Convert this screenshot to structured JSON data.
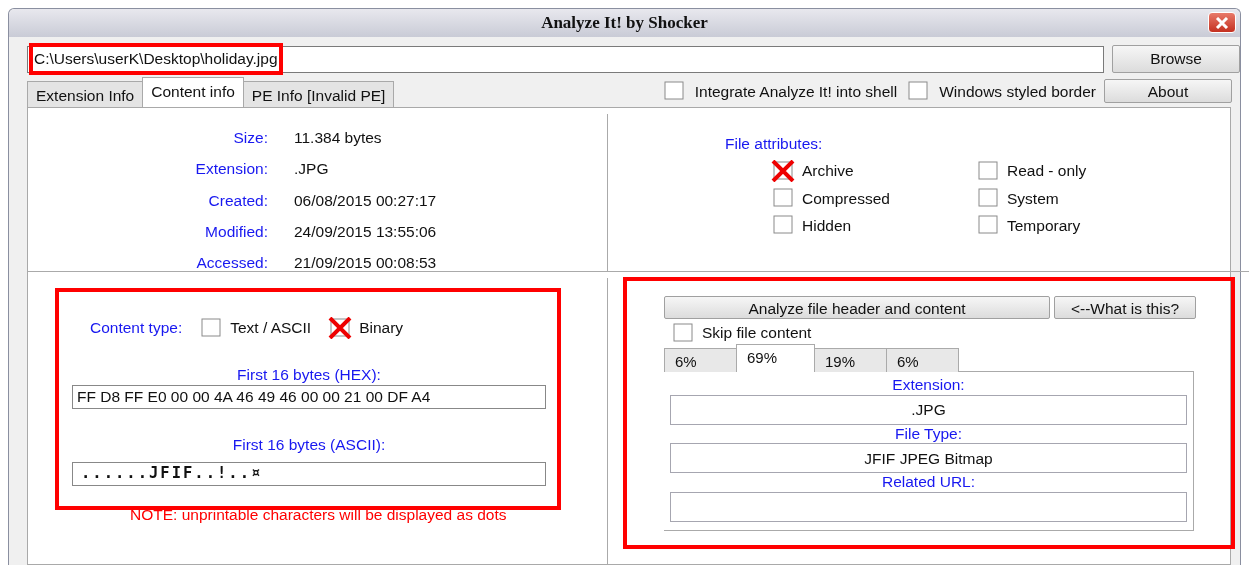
{
  "window": {
    "title": "Analyze It! by Shocker"
  },
  "path": {
    "value": "C:\\Users\\userK\\Desktop\\holiday.jpg",
    "highlighted": true
  },
  "buttons": [
    "Browse",
    "About"
  ],
  "tabs": [
    {
      "label": "Extension Info",
      "selected": false
    },
    {
      "label": "Content info",
      "selected": true
    },
    {
      "label": "PE Info [Invalid PE]",
      "selected": false
    }
  ],
  "options": [
    {
      "label": "Integrate Analyze It! into shell",
      "checked": false
    },
    {
      "label": "Windows styled border",
      "checked": false
    }
  ],
  "file_info": [
    {
      "label": "Size:",
      "value": "11.384 bytes"
    },
    {
      "label": "Extension:",
      "value": ".JPG"
    },
    {
      "label": "Created:",
      "value": "06/08/2015 00:27:17"
    },
    {
      "label": "Modified:",
      "value": "24/09/2015 13:55:06"
    },
    {
      "label": "Accessed:",
      "value": "21/09/2015 00:08:53"
    }
  ],
  "file_attributes": {
    "title": "File attributes:",
    "items": [
      {
        "label": "Archive",
        "checked": true
      },
      {
        "label": "Read - only",
        "checked": false
      },
      {
        "label": "Compressed",
        "checked": false
      },
      {
        "label": "System",
        "checked": false
      },
      {
        "label": "Hidden",
        "checked": false
      },
      {
        "label": "Temporary",
        "checked": false
      }
    ]
  },
  "content": {
    "highlighted": true,
    "type_label": "Content type:",
    "types": [
      {
        "label": "Text / ASCII",
        "checked": false
      },
      {
        "label": "Binary",
        "checked": true
      }
    ],
    "hex_label": "First 16 bytes (HEX):",
    "hex": "FF D8 FF E0 00 00 4A 46 49 46 00 00 21 00 DF A4",
    "ascii_label": "First 16 bytes (ASCII):",
    "ascii": "......JFIF..!..¤",
    "note": "NOTE: unprintable characters will be displayed as dots"
  },
  "analysis": {
    "highlighted": true,
    "analyze_button": "Analyze file header and content",
    "help_button": "<--What is this?",
    "skip": {
      "label": "Skip file content",
      "checked": false
    },
    "tabs": [
      {
        "label": "6%",
        "selected": false
      },
      {
        "label": "69%",
        "selected": true
      },
      {
        "label": "19%",
        "selected": false
      },
      {
        "label": "6%",
        "selected": false
      }
    ],
    "fields": [
      {
        "label": "Extension:",
        "value": ".JPG"
      },
      {
        "label": "File Type:",
        "value": "JFIF JPEG Bitmap"
      },
      {
        "label": "Related URL:"
      }
    ]
  }
}
